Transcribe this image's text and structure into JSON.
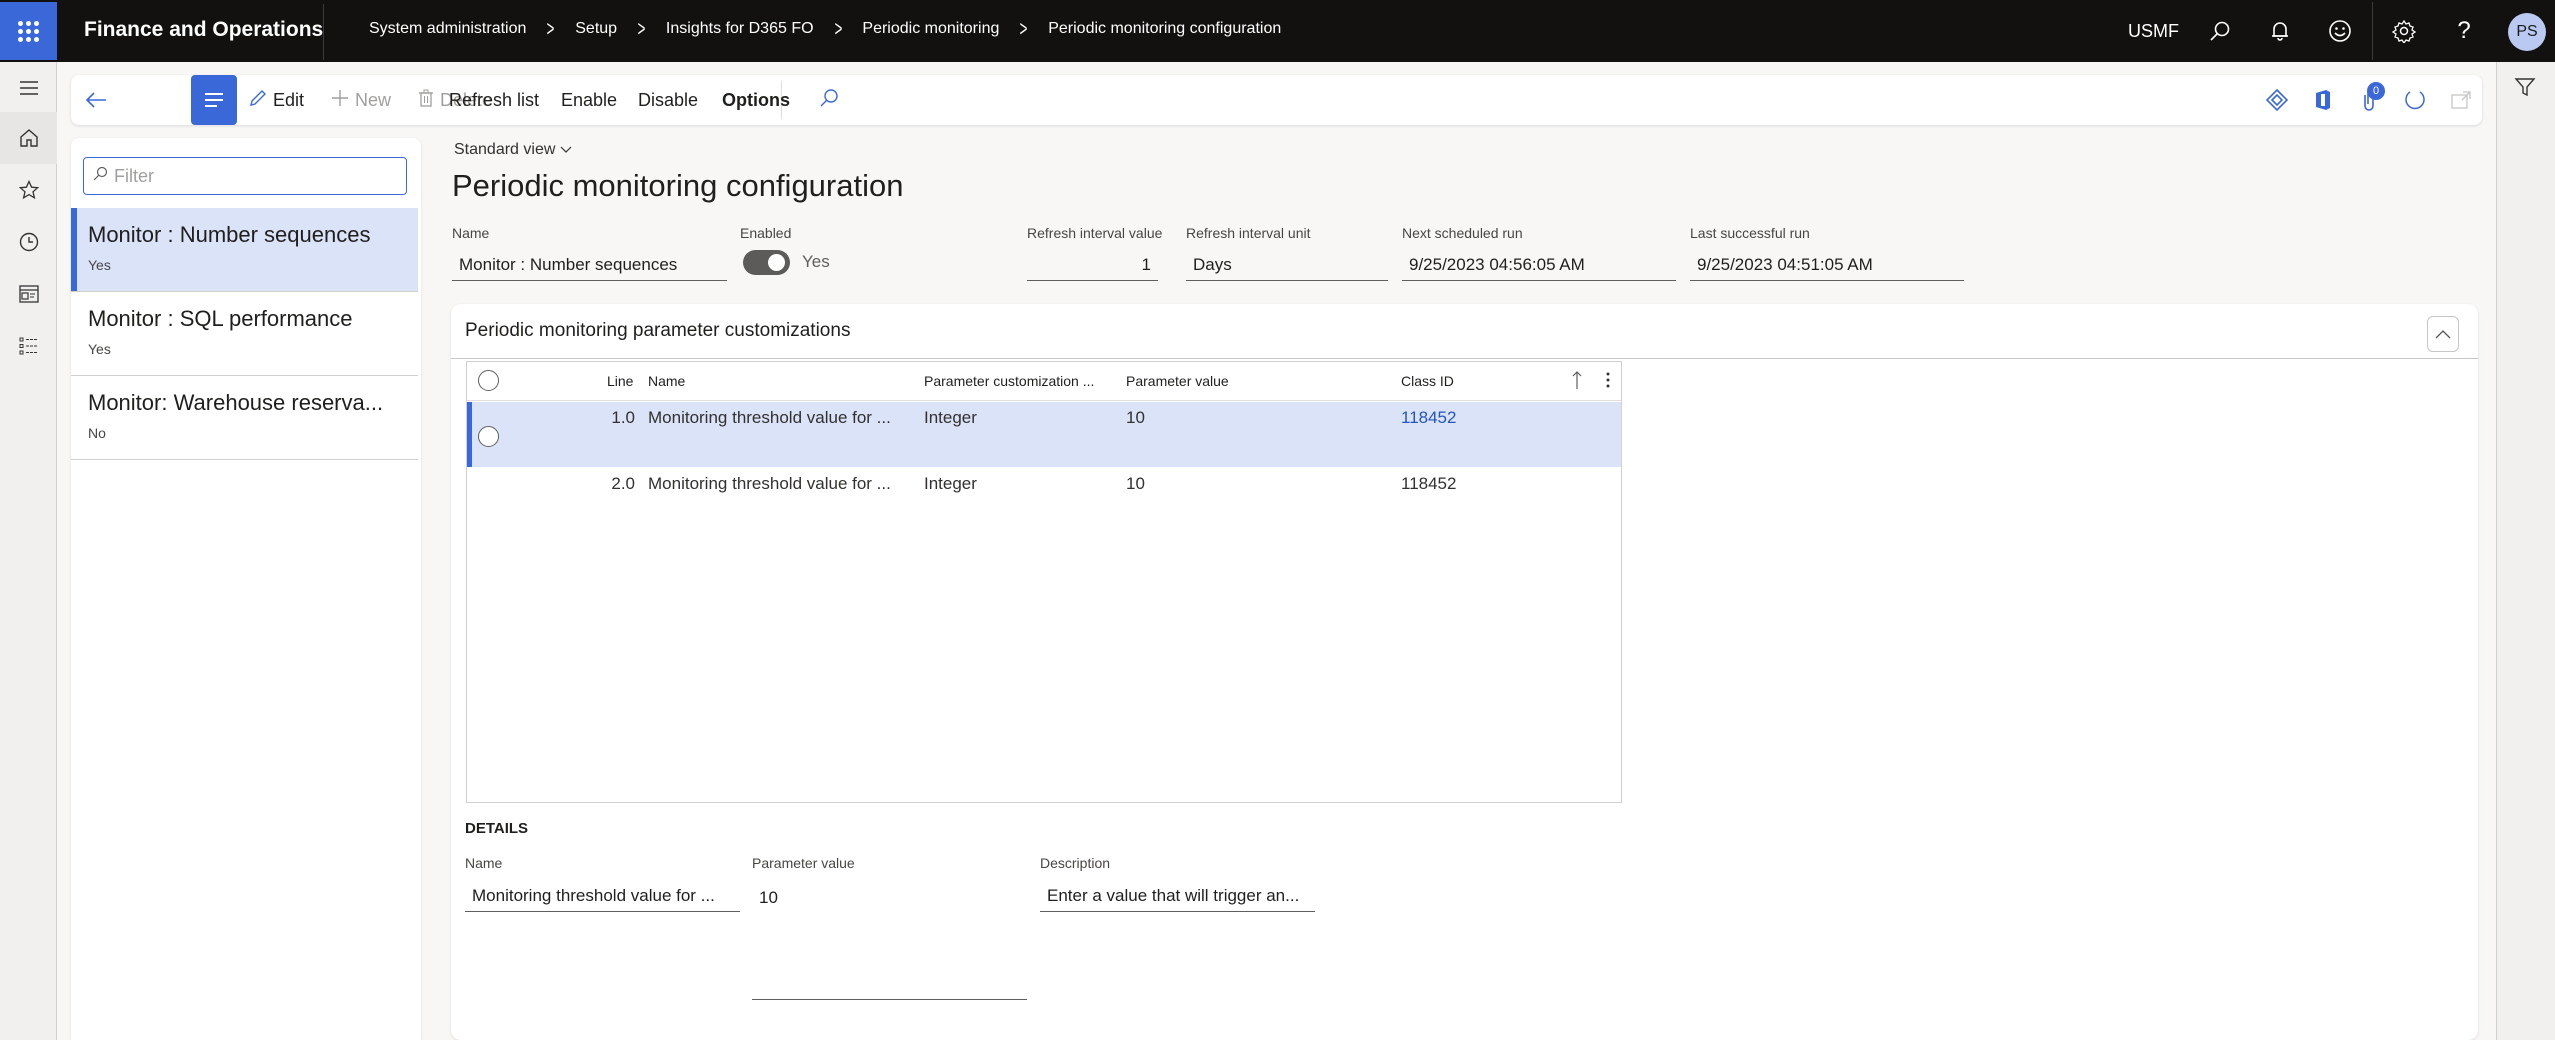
{
  "topbar": {
    "app_title": "Finance and Operations",
    "breadcrumbs": [
      "System administration",
      "Setup",
      "Insights for D365 FO",
      "Periodic monitoring",
      "Periodic monitoring configuration"
    ],
    "company": "USMF",
    "avatar_initials": "PS",
    "icons": [
      "search-icon",
      "bell-icon",
      "smiley-icon",
      "gear-icon",
      "help-icon"
    ]
  },
  "nav_rail": {
    "items": [
      "hamburger-icon",
      "home-icon",
      "star-icon",
      "clock-icon",
      "workspace-icon",
      "list-icon"
    ]
  },
  "toolbar": {
    "edit": "Edit",
    "new": "New",
    "delete": "Delete",
    "refresh_list": "Refresh list",
    "enable": "Enable",
    "disable": "Disable",
    "options": "Options",
    "attachments_count": "0"
  },
  "list": {
    "filter_placeholder": "Filter",
    "items": [
      {
        "title": "Monitor : Number sequences",
        "enabled": "Yes",
        "selected": true
      },
      {
        "title": "Monitor : SQL performance",
        "enabled": "Yes",
        "selected": false
      },
      {
        "title": "Monitor: Warehouse reserva...",
        "enabled": "No",
        "selected": false
      }
    ]
  },
  "header": {
    "view": "Standard view",
    "title": "Periodic monitoring configuration",
    "fields": {
      "name_label": "Name",
      "name_value": "Monitor : Number sequences",
      "enabled_label": "Enabled",
      "enabled_value": "Yes",
      "enabled_on": true,
      "interval_value_label": "Refresh interval value",
      "interval_value": "1",
      "interval_unit_label": "Refresh interval unit",
      "interval_unit": "Days",
      "next_run_label": "Next scheduled run",
      "next_run": "9/25/2023 04:56:05 AM",
      "last_run_label": "Last successful run",
      "last_run": "9/25/2023 04:51:05 AM"
    }
  },
  "fasttab": {
    "title": "Periodic monitoring parameter customizations",
    "grid": {
      "columns": [
        "Line",
        "Name",
        "Parameter customization ...",
        "Parameter value",
        "Class ID"
      ],
      "rows": [
        {
          "line": "1.0",
          "name": "Monitoring threshold value for ...",
          "type": "Integer",
          "value": "10",
          "class_id": "118452",
          "selected": true
        },
        {
          "line": "2.0",
          "name": "Monitoring threshold value for ...",
          "type": "Integer",
          "value": "10",
          "class_id": "118452",
          "selected": false
        }
      ]
    },
    "details": {
      "header": "DETAILS",
      "name_label": "Name",
      "name_value": "Monitoring threshold value for ...",
      "param_label": "Parameter value",
      "param_value": "10",
      "desc_label": "Description",
      "desc_value": "Enter a value that will trigger an..."
    }
  },
  "colors": {
    "accent": "#3b68d9",
    "selected_bg": "#dbe3f9",
    "topbar_bg": "#121110",
    "link": "#2456b8"
  }
}
